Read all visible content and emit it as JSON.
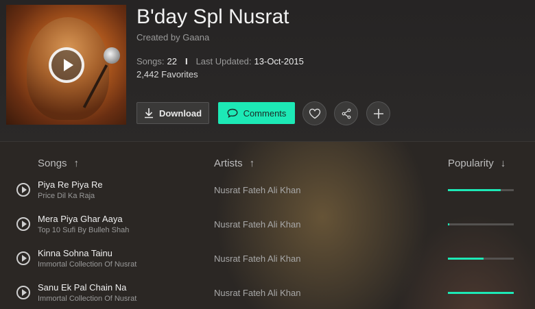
{
  "playlist": {
    "title": "B'day Spl Nusrat",
    "created_by": "Created by Gaana",
    "songs_label": "Songs:",
    "songs_count": "22",
    "separator": "I",
    "updated_label": "Last Updated:",
    "updated_value": "13-Oct-2015",
    "favorites": "2,442 Favorites"
  },
  "actions": {
    "download_label": "Download",
    "comments_label": "Comments"
  },
  "colors": {
    "accent": "#1de9b6",
    "background": "#2a2623"
  },
  "table": {
    "headers": {
      "songs": "Songs",
      "artists": "Artists",
      "popularity": "Popularity",
      "songs_sort": "↑",
      "artists_sort": "↑",
      "popularity_sort": "↓"
    },
    "rows": [
      {
        "song": "Piya Re Piya Re",
        "album": "Price Dil Ka Raja",
        "artist": "Nusrat Fateh Ali Khan",
        "popularity": 0.8
      },
      {
        "song": "Mera Piya Ghar Aaya",
        "album": "Top 10 Sufi By Bulleh Shah",
        "artist": "Nusrat Fateh Ali Khan",
        "popularity": 0.02
      },
      {
        "song": "Kinna Sohna Tainu",
        "album": "Immortal Collection Of Nusrat",
        "artist": "Nusrat Fateh Ali Khan",
        "popularity": 0.54
      },
      {
        "song": "Sanu Ek Pal Chain Na",
        "album": "Immortal Collection Of Nusrat",
        "artist": "Nusrat Fateh Ali Khan",
        "popularity": 1.0
      }
    ]
  }
}
